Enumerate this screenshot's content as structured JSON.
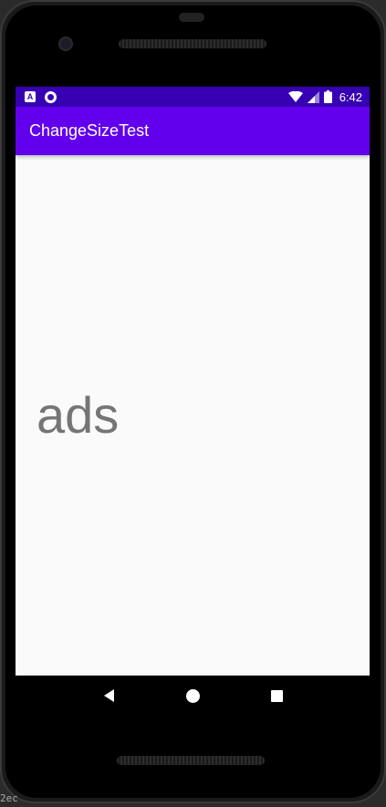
{
  "status_bar": {
    "notification_icons": [
      "app-a-notification-icon",
      "circle-notification-icon"
    ],
    "system_icons": [
      "wifi-icon",
      "cell-signal-icon",
      "battery-icon"
    ],
    "time": "6:42",
    "color": "#3700b3"
  },
  "app_bar": {
    "title": "ChangeSizeTest",
    "color": "#6200ee"
  },
  "content": {
    "text": "ads",
    "text_color": "#757575"
  },
  "nav_bar": {
    "buttons": [
      "back-icon",
      "home-icon",
      "recents-icon"
    ]
  },
  "corner_label": "2ec"
}
